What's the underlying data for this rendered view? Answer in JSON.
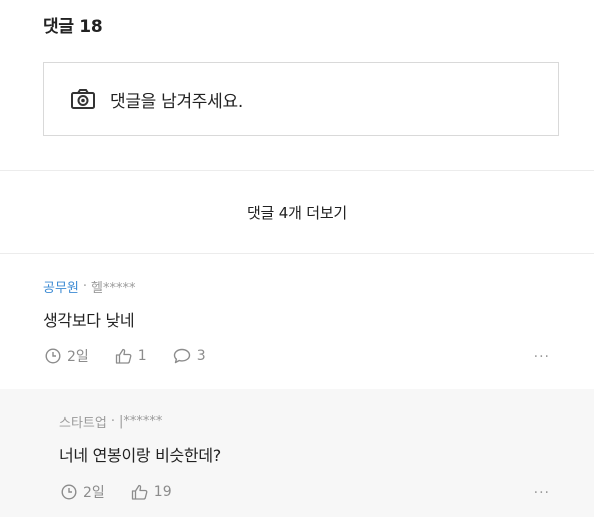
{
  "header": {
    "title": "댓글 18"
  },
  "input_box": {
    "placeholder": "댓글을 남겨주세요.",
    "icon": "camera-icon"
  },
  "more_comments": {
    "label": "댓글 4개 더보기"
  },
  "comments": [
    {
      "company": "공무원",
      "separator": "·",
      "author": "헬*****",
      "text": "생각보다 낮네",
      "time": "2일",
      "likes": "1",
      "replies": "3",
      "more": "···"
    }
  ],
  "replies": [
    {
      "company": "스타트업",
      "separator": "·",
      "author": "|******",
      "text": "너네 연봉이랑 비슷한데?",
      "time": "2일",
      "likes": "19",
      "more": "···"
    }
  ],
  "colors": {
    "company_accent": "#3d8bd4",
    "reply_background": "#f7f7f7"
  }
}
